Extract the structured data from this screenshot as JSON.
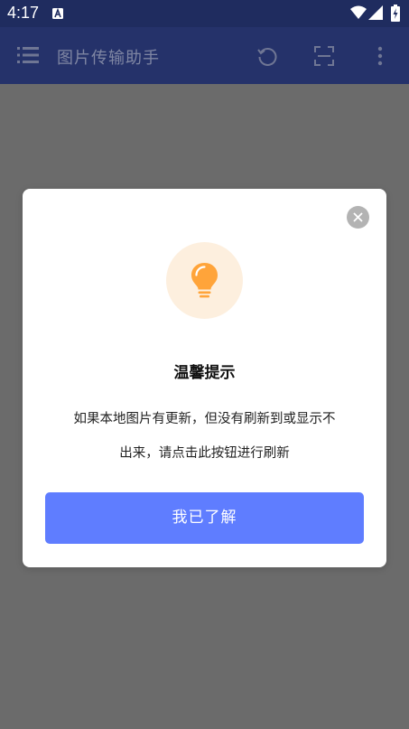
{
  "status_bar": {
    "time": "4:17",
    "icons": [
      "a-notification-icon",
      "wifi-icon",
      "signal-icon",
      "battery-charging-icon"
    ]
  },
  "toolbar": {
    "title": "图片传输助手",
    "icons": [
      "menu-icon",
      "refresh-icon",
      "scan-icon",
      "more-vert-icon"
    ]
  },
  "dialog": {
    "title": "温馨提示",
    "message_line1": "如果本地图片有更新，但没有刷新到或显示不",
    "message_line2": "出来，请点击此按钮进行刷新",
    "confirm_label": "我已了解",
    "icons": [
      "lightbulb-icon",
      "close-icon"
    ]
  },
  "colors": {
    "status_bar": "#1f2c5f",
    "toolbar": "#25326a",
    "overlay": "#6b6b6b",
    "accent_button": "#5f7dff",
    "bulb": "#ffa43a",
    "bulb_bg": "#fdefde"
  }
}
